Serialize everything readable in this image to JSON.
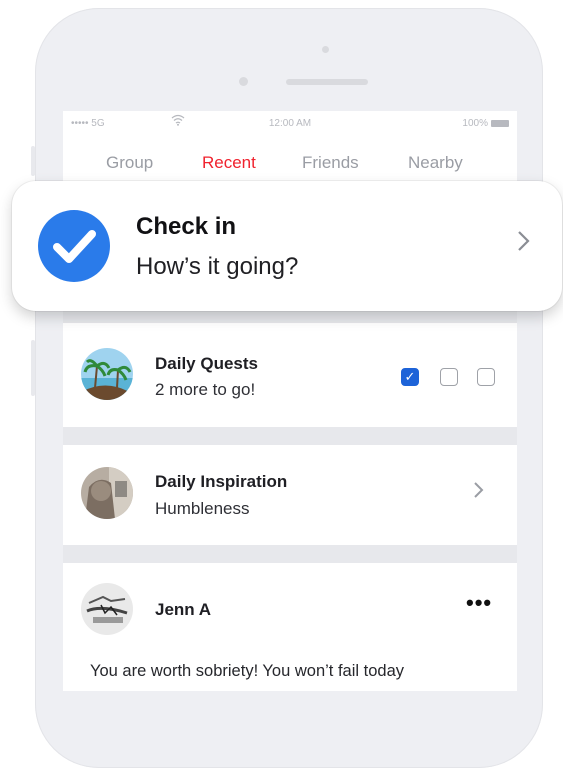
{
  "status_bar": {
    "carrier": "••••• 5G",
    "time": "12:00 AM",
    "battery_pct": "100%"
  },
  "tabs": [
    {
      "label": "Group",
      "active": false
    },
    {
      "label": "Recent",
      "active": true
    },
    {
      "label": "Friends",
      "active": false
    },
    {
      "label": "Nearby",
      "active": false
    }
  ],
  "notification": {
    "title": "Check in",
    "subtitle": "How’s it going?",
    "icon": "check-circle-icon"
  },
  "daily_quests": {
    "title": "Daily Quests",
    "subtitle": "2 more to go!",
    "checkboxes": [
      true,
      false,
      false
    ]
  },
  "daily_inspiration": {
    "title": "Daily Inspiration",
    "subtitle": "Humbleness"
  },
  "post": {
    "author": "Jenn A",
    "more_label": "•••",
    "text": "You are worth sobriety! You won’t fail today"
  },
  "colors": {
    "accent_red": "#f0222e",
    "check_blue": "#2a7bea",
    "checkbox_blue": "#1d63d8"
  }
}
